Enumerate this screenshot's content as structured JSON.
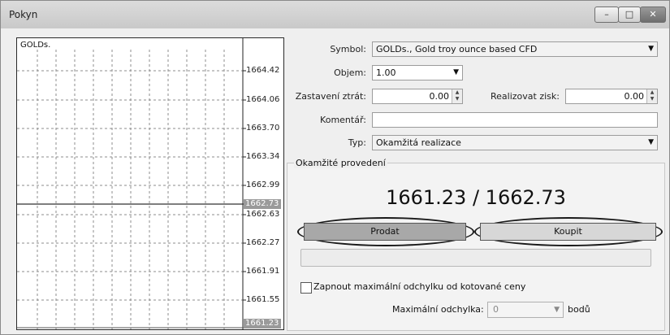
{
  "window": {
    "title": "Pokyn",
    "min_label": "–",
    "max_label": "□",
    "close_label": "✕"
  },
  "chart": {
    "symbol": "GOLDs.",
    "price_ticks": [
      "1664.42",
      "1664.06",
      "1663.70",
      "1663.34",
      "1662.99",
      "1662.63",
      "1662.27",
      "1661.91",
      "1661.55"
    ],
    "ask_tag": "1662.73",
    "bid_tag": "1661.23"
  },
  "form": {
    "symbol_label": "Symbol:",
    "symbol_value": "GOLDs., Gold troy ounce based CFD",
    "volume_label": "Objem:",
    "volume_value": "1.00",
    "stoploss_label": "Zastavení ztrát:",
    "stoploss_value": "0.00",
    "takeprofit_label": "Realizovat zisk:",
    "takeprofit_value": "0.00",
    "comment_label": "Komentář:",
    "comment_value": "",
    "type_label": "Typ:",
    "type_value": "Okamžitá realizace"
  },
  "execution": {
    "group_title": "Okamžité provedení",
    "price_display": "1661.23 / 1662.73",
    "sell_label": "Prodat",
    "buy_label": "Koupit",
    "max_deviation_checkbox_label": "Zapnout maximální odchylku od kotované ceny",
    "max_deviation_label": "Maximální odchylka:",
    "max_deviation_value": "0",
    "max_deviation_unit": "bodů"
  }
}
